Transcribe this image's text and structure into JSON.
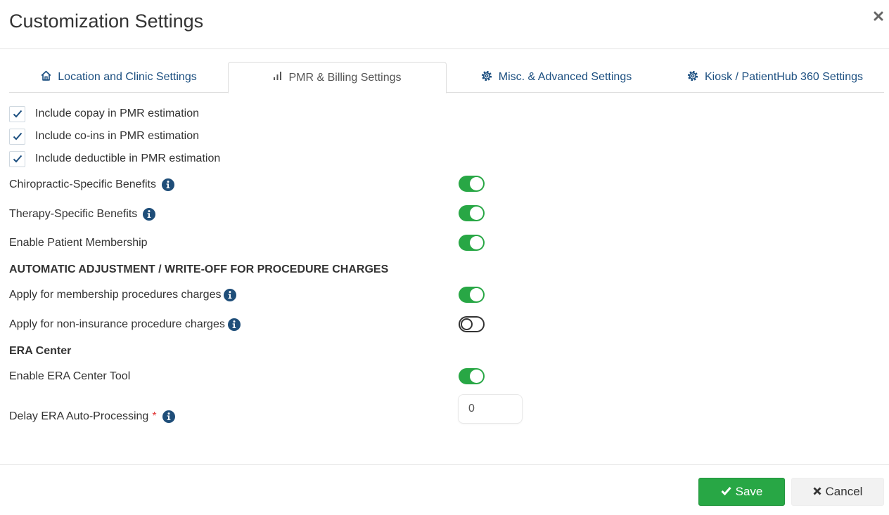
{
  "dialog": {
    "title": "Customization Settings"
  },
  "tabs": [
    {
      "label": "Location and Clinic Settings",
      "icon": "home-icon"
    },
    {
      "label": "PMR & Billing Settings",
      "icon": "bar-chart-icon",
      "active": true
    },
    {
      "label": "Misc. & Advanced Settings",
      "icon": "gear-icon"
    },
    {
      "label": "Kiosk / PatientHub 360 Settings",
      "icon": "gear-icon"
    }
  ],
  "checkboxes": [
    {
      "label": "Include copay in PMR estimation",
      "checked": true
    },
    {
      "label": "Include co-ins in PMR estimation",
      "checked": true
    },
    {
      "label": "Include deductible in PMR estimation",
      "checked": true
    }
  ],
  "benefits": {
    "chiropractic": {
      "label": "Chiropractic-Specific Benefits",
      "enabled": true
    },
    "therapy": {
      "label": "Therapy-Specific Benefits",
      "enabled": true
    },
    "membership": {
      "label": "Enable Patient Membership",
      "enabled": true
    }
  },
  "adjustment": {
    "heading": "AUTOMATIC ADJUSTMENT / WRITE-OFF FOR PROCEDURE CHARGES",
    "membership_charges": {
      "label": "Apply for membership procedures charges",
      "enabled": true
    },
    "non_insurance_charges": {
      "label": "Apply for non-insurance procedure charges",
      "enabled": false
    }
  },
  "era": {
    "heading": "ERA Center",
    "tool": {
      "label": "Enable ERA Center Tool",
      "enabled": true
    },
    "delay": {
      "label": "Delay ERA Auto-Processing",
      "required_mark": "*",
      "value": "0"
    }
  },
  "footer": {
    "save_label": "Save",
    "cancel_label": "Cancel"
  },
  "colors": {
    "accent_green": "#28a745",
    "link_blue": "#1c4f80",
    "info_blue": "#1f4e79",
    "required_red": "#e23b3b"
  }
}
